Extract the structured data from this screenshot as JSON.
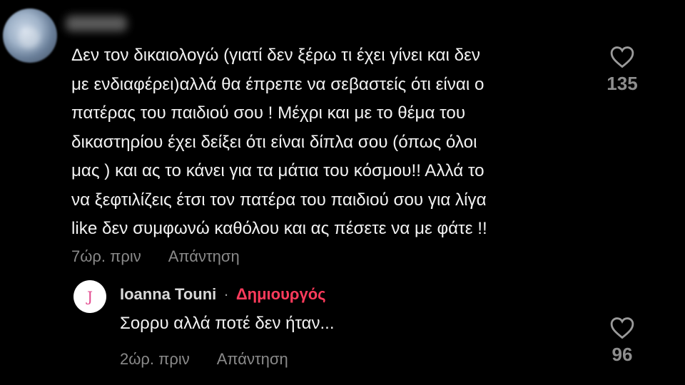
{
  "comment": {
    "username": "",
    "text": "Δεν τον δικαιολογώ (γιατί δεν ξέρω τι έχει γίνει και δεν\nμε ενδιαφέρει)αλλά θα έπρεπε να σεβαστείς ότι είναι ο\nπατέρας του παιδιού σου ! Μέχρι και με το θέμα του\nδικαστηρίου έχει δείξει ότι είναι δίπλα σου (όπως όλοι\nμας ) και ας το κάνει για τα μάτια του κόσμου!! Αλλά το\nνα ξεφτιλίζεις έτσι τον πατέρα του παιδιού σου για λίγα\nlike δεν συμφωνώ καθόλου και ας πέσετε να με φάτε !!",
    "time": "7ώρ. πριν",
    "reply_label": "Απάντηση",
    "like_count": "135",
    "like_icon": "heart-outline-icon"
  },
  "reply": {
    "avatar_letter": "J",
    "username": "Ioanna Touni",
    "separator": "·",
    "creator_label": "Δημιουργός",
    "text": "Σορρυ αλλά ποτέ δεν ήταν...",
    "time": "2ώρ. πριν",
    "reply_label": "Απάντηση",
    "like_count": "96",
    "like_icon": "heart-outline-icon"
  },
  "colors": {
    "background": "#000000",
    "text": "#f2f2f2",
    "muted": "#8a8a8a",
    "creator": "#ff3b5c",
    "avatar_letter": "#e2468c"
  }
}
